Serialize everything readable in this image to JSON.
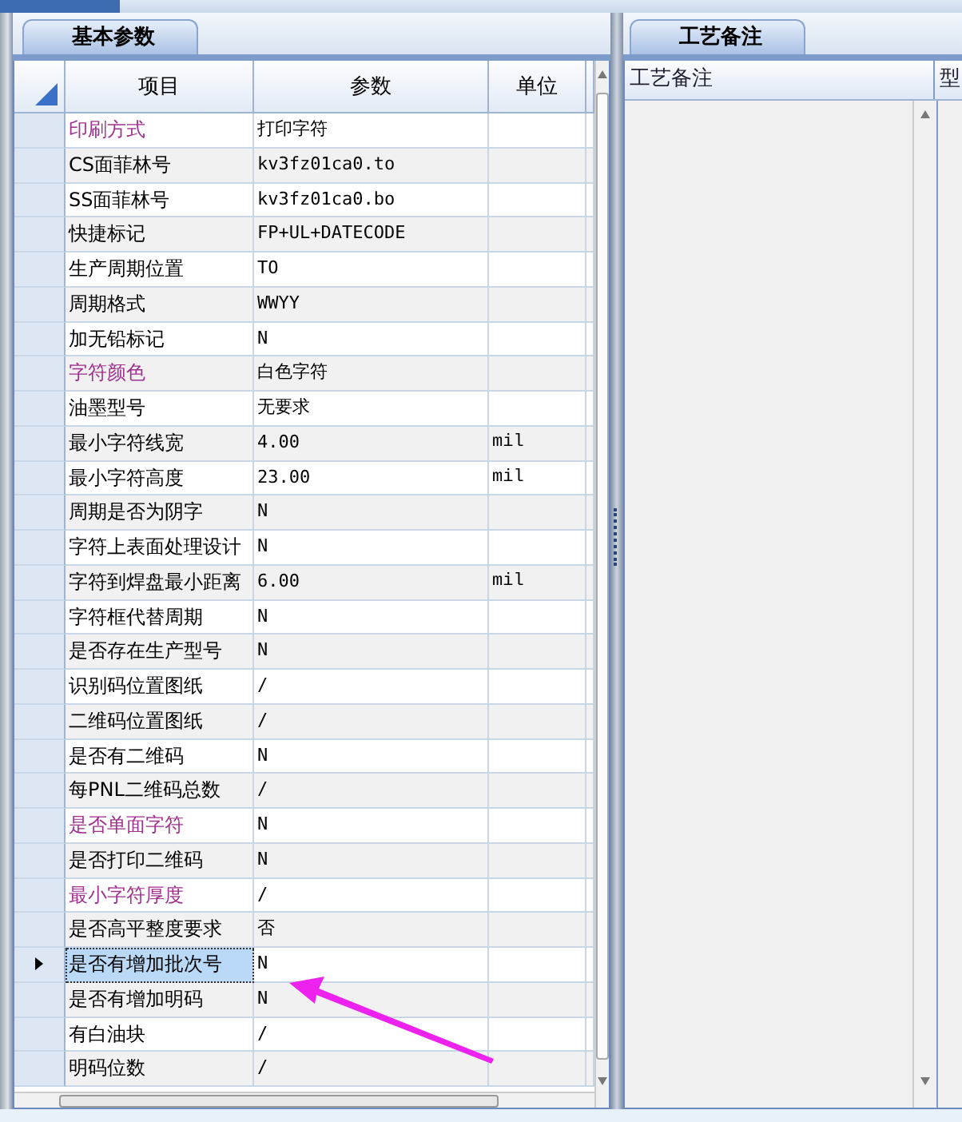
{
  "left_panel": {
    "tab": {
      "label": "基本参数",
      "selected": true
    },
    "columns": [
      "项目",
      "参数",
      "单位"
    ],
    "rows": [
      {
        "item": "印刷方式",
        "value": "打印字符",
        "emphasized": true,
        "selected": false
      },
      {
        "item": "CS面菲林号",
        "value": "kv3fz01ca0.to",
        "emphasized": false,
        "selected": false
      },
      {
        "item": "SS面菲林号",
        "value": "kv3fz01ca0.bo",
        "emphasized": false,
        "selected": false
      },
      {
        "item": "快捷标记",
        "value": "FP+UL+DATECODE",
        "emphasized": false,
        "selected": false
      },
      {
        "item": "生产周期位置",
        "value": "TO",
        "emphasized": false,
        "selected": false
      },
      {
        "item": "周期格式",
        "value": "WWYY",
        "emphasized": false,
        "selected": false
      },
      {
        "item": "加无铅标记",
        "value": "N",
        "emphasized": false,
        "selected": false
      },
      {
        "item": "字符颜色",
        "value": "白色字符",
        "emphasized": true,
        "selected": false
      },
      {
        "item": "油墨型号",
        "value": "无要求",
        "emphasized": false,
        "selected": false
      },
      {
        "item": "最小字符线宽",
        "value": "4.00",
        "unit": "mil",
        "emphasized": false,
        "selected": false
      },
      {
        "item": "最小字符高度",
        "value": "23.00",
        "unit": "mil",
        "emphasized": false,
        "selected": false
      },
      {
        "item": "周期是否为阴字",
        "value": "N",
        "emphasized": false,
        "selected": false
      },
      {
        "item": "字符上表面处理设计",
        "value": "N",
        "emphasized": false,
        "selected": false
      },
      {
        "item": "字符到焊盘最小距离",
        "value": "6.00",
        "unit": "mil",
        "emphasized": false,
        "selected": false
      },
      {
        "item": "字符框代替周期",
        "value": "N",
        "emphasized": false,
        "selected": false
      },
      {
        "item": "是否存在生产型号",
        "value": "N",
        "emphasized": false,
        "selected": false
      },
      {
        "item": "识别码位置图纸",
        "value": "/",
        "emphasized": false,
        "selected": false
      },
      {
        "item": "二维码位置图纸",
        "value": "/",
        "emphasized": false,
        "selected": false
      },
      {
        "item": "是否有二维码",
        "value": "N",
        "emphasized": false,
        "selected": false
      },
      {
        "item": "每PNL二维码总数",
        "value": "/",
        "emphasized": false,
        "selected": false
      },
      {
        "item": "是否单面字符",
        "value": "N",
        "emphasized": true,
        "selected": false
      },
      {
        "item": "是否打印二维码",
        "value": "N",
        "emphasized": false,
        "selected": false
      },
      {
        "item": "最小字符厚度",
        "value": "/",
        "emphasized": true,
        "selected": false
      },
      {
        "item": "是否高平整度要求",
        "value": "否",
        "emphasized": false,
        "selected": false
      },
      {
        "item": "是否有增加批次号",
        "value": "N",
        "emphasized": false,
        "selected": true
      },
      {
        "item": "是否有增加明码",
        "value": "N",
        "emphasized": false,
        "selected": false
      },
      {
        "item": "有白油块",
        "value": "/",
        "emphasized": false,
        "selected": false
      },
      {
        "item": "明码位数",
        "value": "/",
        "emphasized": false,
        "selected": false
      }
    ]
  },
  "right_panel": {
    "tab": {
      "label": "工艺备注",
      "selected": true
    },
    "columns": [
      "工艺备注",
      "型"
    ]
  }
}
